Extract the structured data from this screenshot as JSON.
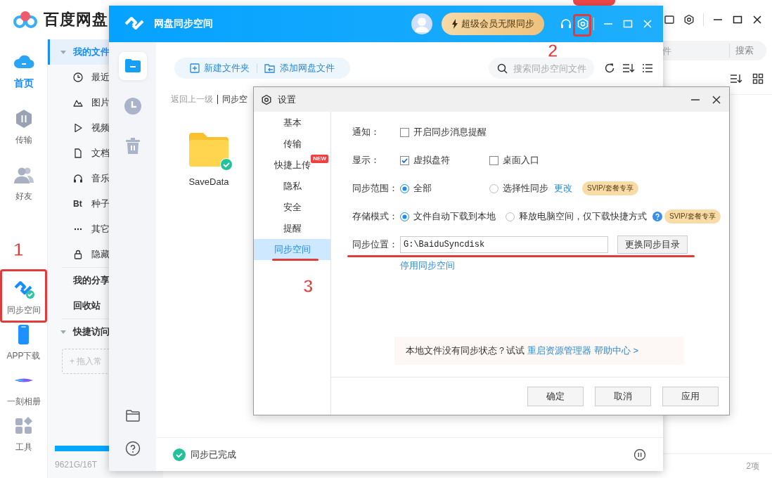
{
  "main_window": {
    "logo_text": "百度网盘",
    "rail": [
      {
        "label": "首页",
        "selected": true
      },
      {
        "label": "传输",
        "selected": false
      },
      {
        "label": "好友",
        "selected": false
      },
      {
        "label": "同步空间",
        "selected": false
      },
      {
        "label": "APP下载",
        "selected": false
      },
      {
        "label": "一刻相册",
        "selected": false
      },
      {
        "label": "工具",
        "selected": false
      }
    ],
    "tree": [
      {
        "label": "我的文件",
        "selected": true,
        "expanded": true,
        "children": [
          {
            "label": "最近",
            "selected": false
          },
          {
            "label": "图片",
            "selected": false
          },
          {
            "label": "视频",
            "selected": false
          },
          {
            "label": "文档",
            "selected": false
          },
          {
            "label": "音乐",
            "selected": false
          },
          {
            "label": "种子",
            "selected": false,
            "glyph": "Bt"
          },
          {
            "label": "其它",
            "selected": false
          },
          {
            "label": "隐藏",
            "selected": false
          }
        ]
      },
      {
        "label": "我的分享",
        "selected": false
      },
      {
        "label": "回收站",
        "selected": false
      },
      {
        "label": "快捷访问",
        "selected": false,
        "expanded": true,
        "drop_hint": "+ 拖入常"
      }
    ],
    "storage": {
      "text": "9621G/16T",
      "level": 0.59
    },
    "search": {
      "placeholder": "件",
      "button": "搜索"
    },
    "item_count": "2项"
  },
  "sync_window": {
    "title": "网盘同步空间",
    "vip_button": "超级会员无限同步",
    "rail": [
      {
        "selected": true
      },
      {
        "selected": false
      },
      {
        "selected": false
      }
    ],
    "toolbar": {
      "new_folder": "新建文件夹",
      "add_files": "添加网盘文件"
    },
    "search": {
      "placeholder": "搜索同步空间文件"
    },
    "breadcrumb": {
      "back": "返回上一级",
      "current": "同步空"
    },
    "files": [
      {
        "name": "SaveData",
        "synced": true
      }
    ],
    "status": "同步已完成"
  },
  "settings_dialog": {
    "title": "设置",
    "nav": [
      {
        "label": "基本",
        "selected": false
      },
      {
        "label": "传输",
        "selected": false
      },
      {
        "label": "快捷上传",
        "selected": false,
        "badge": "NEW"
      },
      {
        "label": "隐私",
        "selected": false
      },
      {
        "label": "安全",
        "selected": false
      },
      {
        "label": "提醒",
        "selected": false
      },
      {
        "label": "同步空间",
        "selected": true
      }
    ],
    "rows": [
      {
        "kind": "checkboxes",
        "label": "通知：",
        "options": [
          {
            "label": "开启同步消息提醒",
            "checked": false
          }
        ]
      },
      {
        "kind": "checkboxes",
        "label": "显示：",
        "options": [
          {
            "label": "虚拟盘符",
            "checked": true
          },
          {
            "label": "桌面入口",
            "checked": false
          }
        ]
      },
      {
        "kind": "radios",
        "label": "同步范围：",
        "options": [
          {
            "label": "全部",
            "selected": true
          },
          {
            "label": "选择性同步",
            "selected": false
          }
        ],
        "link": "更改",
        "help": false,
        "badge": "SVIP/套餐专享"
      },
      {
        "kind": "radios",
        "label": "存储模式：",
        "options": [
          {
            "label": "文件自动下载到本地",
            "selected": true
          },
          {
            "label": "释放电脑空间，仅下载快捷方式",
            "selected": false
          }
        ],
        "help": true,
        "badge": "SVIP/套餐专享"
      },
      {
        "kind": "path",
        "label": "同步位置：",
        "value": "G:\\BaiduSyncdisk",
        "button": "更换同步目录"
      }
    ],
    "disable_link": "停用同步空间",
    "tip": {
      "text": "本地文件没有同步状态？试试",
      "link": "重启资源管理器",
      "help": "帮助中心 >"
    },
    "buttons": [
      "确定",
      "取消",
      "应用"
    ]
  },
  "annotations": [
    {
      "label": "1"
    },
    {
      "label": "2"
    },
    {
      "label": "3"
    }
  ]
}
